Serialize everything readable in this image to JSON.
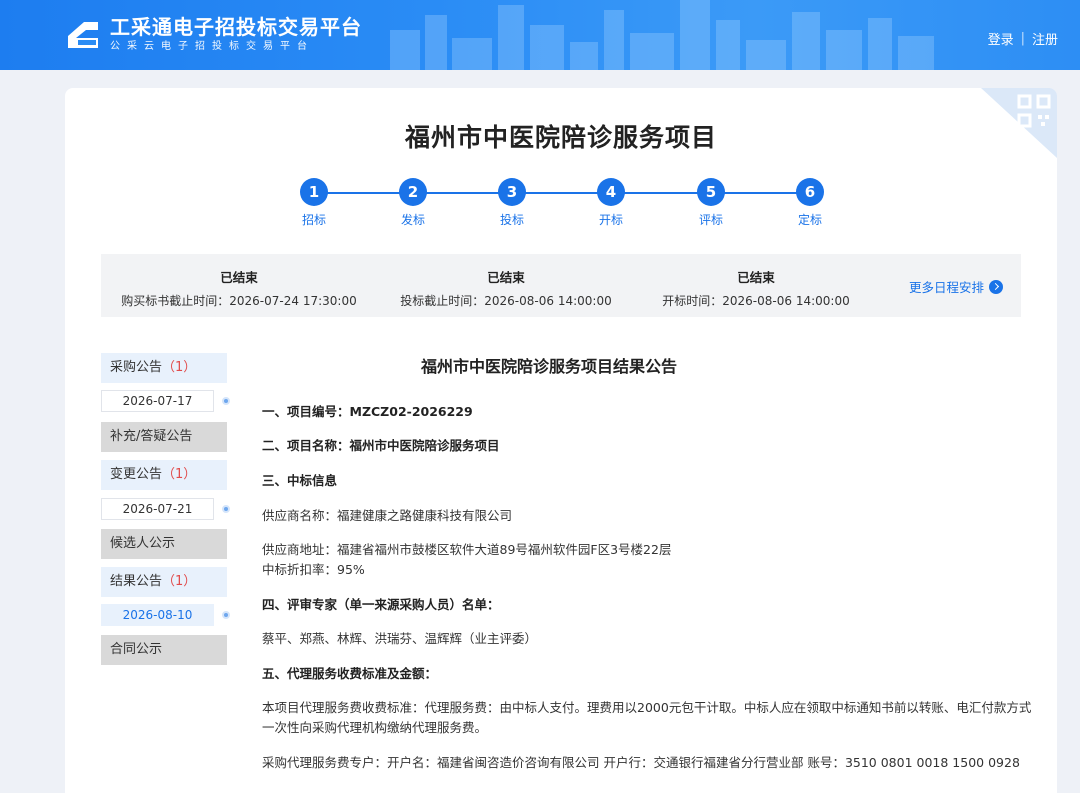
{
  "header": {
    "logo_title": "工采通电子招投标交易平台",
    "logo_subtitle": "公采云电子招投标交易平台",
    "login_label": "登录",
    "separator": "|",
    "register_label": "注册"
  },
  "project_title": "福州市中医院陪诊服务项目",
  "steps": [
    {
      "num": "1",
      "label": "招标"
    },
    {
      "num": "2",
      "label": "发标"
    },
    {
      "num": "3",
      "label": "投标"
    },
    {
      "num": "4",
      "label": "开标"
    },
    {
      "num": "5",
      "label": "评标"
    },
    {
      "num": "6",
      "label": "定标"
    }
  ],
  "schedule": [
    {
      "status": "已结束",
      "detail": "购买标书截止时间：2026-07-24 17:30:00"
    },
    {
      "status": "已结束",
      "detail": "投标截止时间：2026-08-06 14:00:00"
    },
    {
      "status": "已结束",
      "detail": "开标时间：2026-08-06 14:00:00"
    }
  ],
  "more_schedule_label": "更多日程安排",
  "sidebar": {
    "procurement_notice": "采购公告",
    "procurement_count": "（1）",
    "procurement_date": "2026-07-17",
    "supplement_notice": "补充/答疑公告",
    "change_notice": "变更公告",
    "change_count": "（1）",
    "change_date": "2026-07-21",
    "candidate_notice": "候选人公示",
    "result_notice": "结果公告",
    "result_count": "（1）",
    "result_date": "2026-08-10",
    "contract_notice": "合同公示"
  },
  "article": {
    "title": "福州市中医院陪诊服务项目结果公告",
    "l1": "一、项目编号：MZCZ02-2026229",
    "l2": "二、项目名称：福州市中医院陪诊服务项目",
    "l3": "三、中标信息",
    "l4": "供应商名称：福建健康之路健康科技有限公司",
    "l5": "供应商地址：福建省福州市鼓楼区软件大道89号福州软件园F区3号楼22层",
    "l6": "中标折扣率：95%",
    "l7": "四、评审专家（单一来源采购人员）名单：",
    "l8": "蔡平、郑燕、林辉、洪瑞芬、温辉辉（业主评委）",
    "l9": "五、代理服务收费标准及金额：",
    "l10": "本项目代理服务费收费标准：代理服务费：由中标人支付。理费用以2000元包干计取。中标人应在领取中标通知书前以转账、电汇付款方式",
    "l11": "一次性向采购代理机构缴纳代理服务费。",
    "l12": "采购代理服务费专户：开户名：福建省闽咨造价咨询有限公司 开户行：交通银行福建省分行营业部 账号：3510 0801 0018 1500 0928"
  },
  "colors": {
    "brand_blue": "#1a73e8",
    "header_blue": "#2a8cf5",
    "alert_red": "#e14b4b"
  }
}
